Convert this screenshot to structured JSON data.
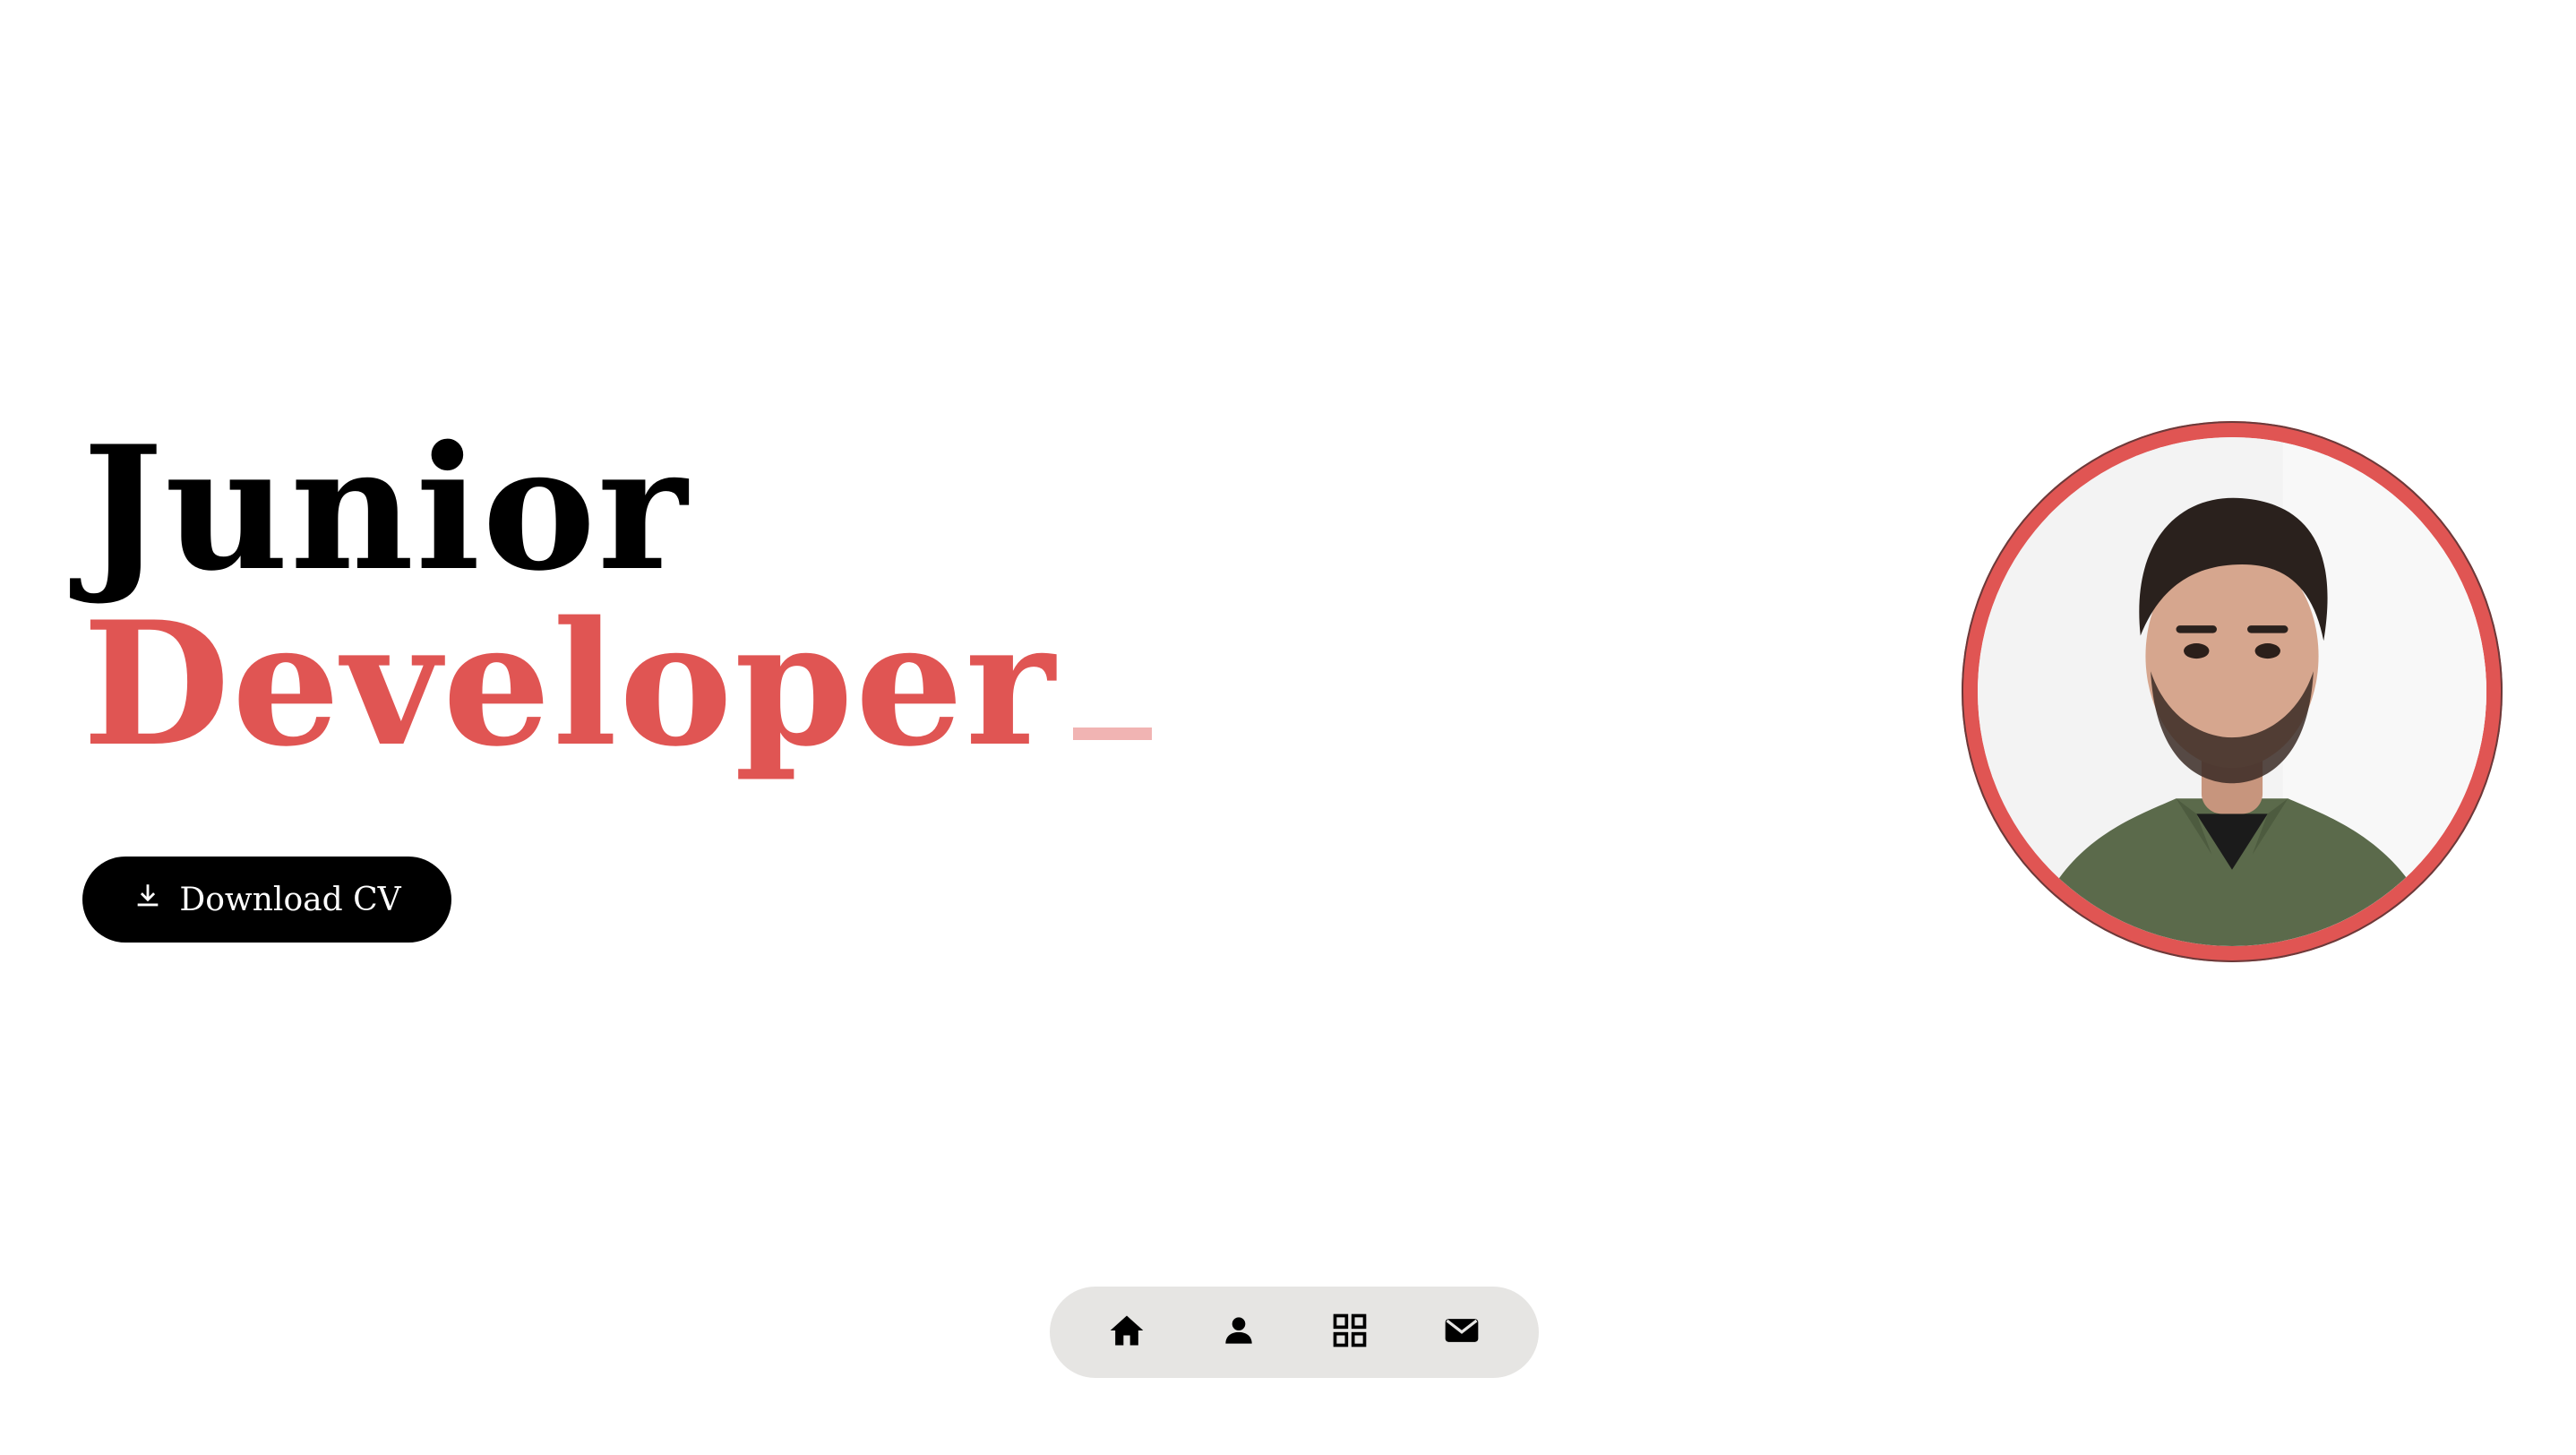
{
  "hero": {
    "line1": "Junior",
    "line2": "Developer",
    "cursor": "_"
  },
  "cta": {
    "label": "Download CV",
    "icon": "download-icon"
  },
  "profile": {
    "avatar": "profile-photo"
  },
  "dock": {
    "items": [
      {
        "icon": "home-icon"
      },
      {
        "icon": "person-icon"
      },
      {
        "icon": "grid-icon"
      },
      {
        "icon": "mail-icon"
      }
    ]
  },
  "colors": {
    "accent": "#e05553",
    "cursor": "#f1b4b3",
    "text": "#000000",
    "dock_bg": "#e6e5e3",
    "button_bg": "#000000",
    "button_text": "#ffffff"
  }
}
